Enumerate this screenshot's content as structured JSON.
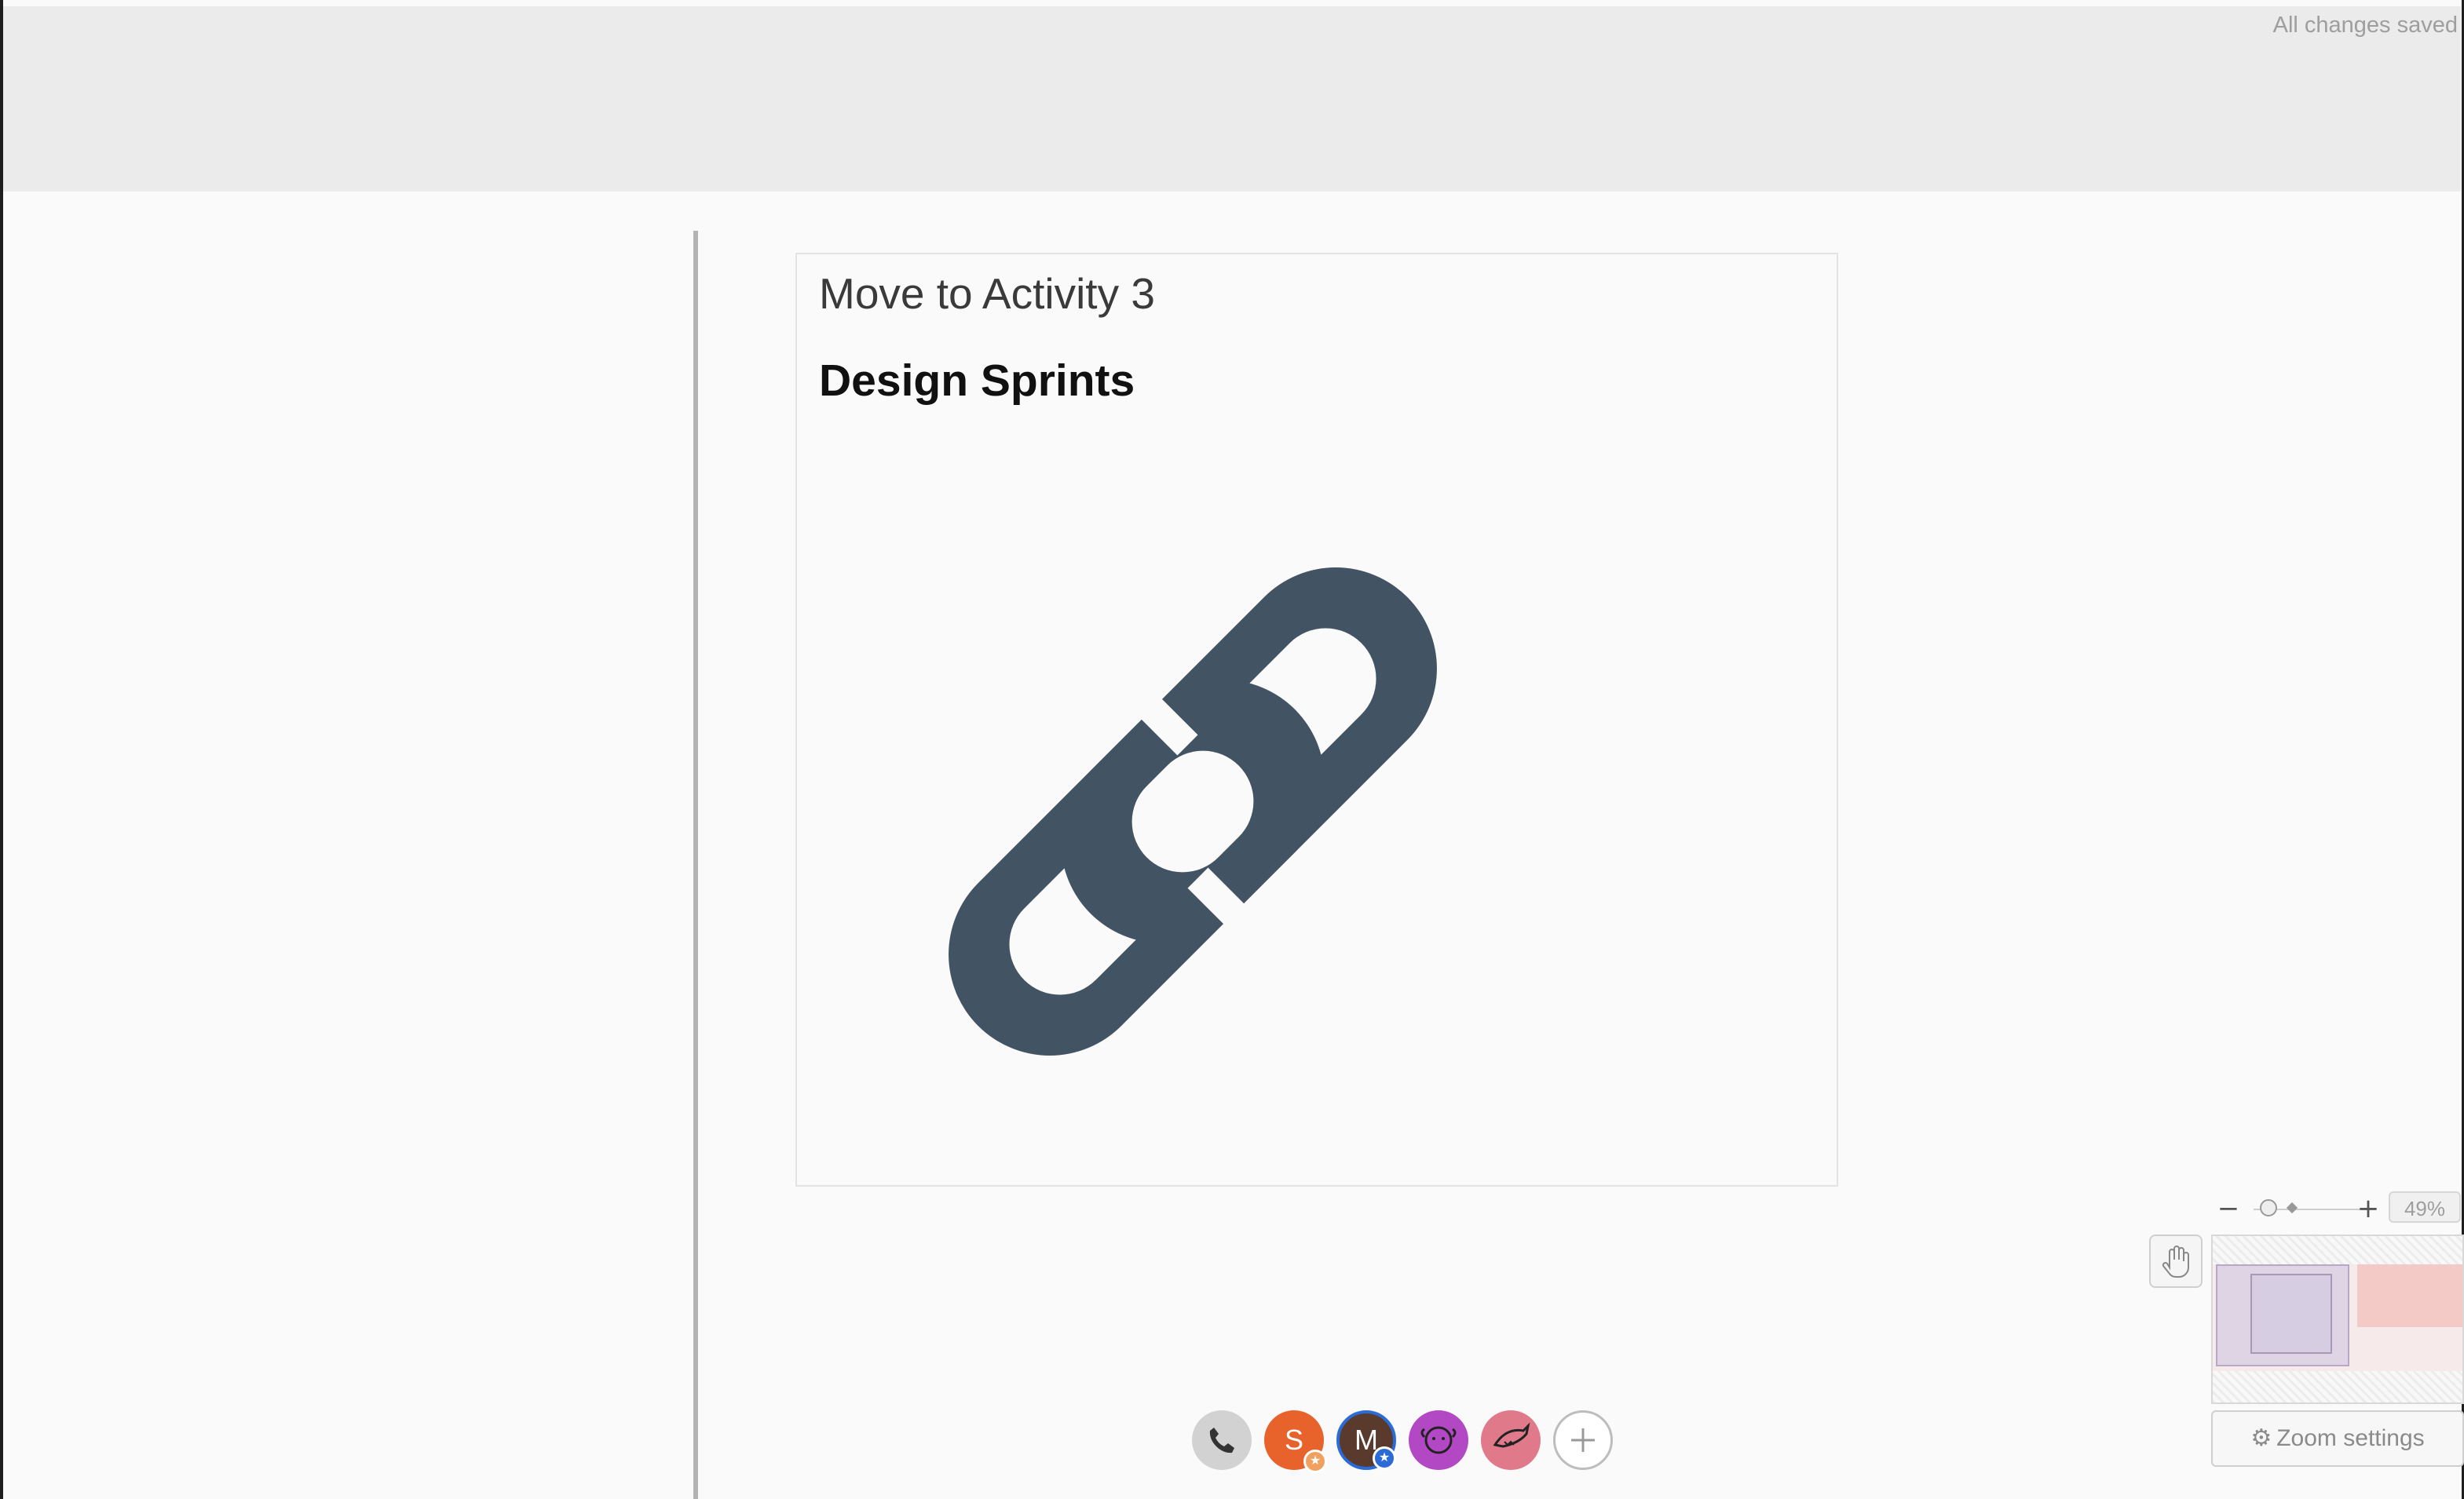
{
  "header": {
    "save_status": "All changes saved"
  },
  "card": {
    "title": "Move to Activity 3",
    "subtitle": "Design Sprints",
    "graphic": "link-icon"
  },
  "zoom": {
    "minus_label": "−",
    "plus_label": "+",
    "percent": "49%",
    "slider_value": 0.49,
    "settings_label": "Zoom settings",
    "settings_icon": "gear-icon"
  },
  "participants": [
    {
      "initial": "",
      "icon": "phone-icon",
      "color": "#cfcfcf"
    },
    {
      "initial": "S",
      "color": "#e8622c",
      "badge_color": "#f0a060"
    },
    {
      "initial": "M",
      "color": "#5b3a2e",
      "badge_color": "#2a6bd6"
    },
    {
      "initial": "",
      "icon": "sheep-icon",
      "color": "#b248c4"
    },
    {
      "initial": "",
      "icon": "shark-icon",
      "color": "#e07a8a"
    },
    {
      "initial": "",
      "icon": "add-participant-icon",
      "color": "#ffffff"
    }
  ],
  "colors": {
    "link_icon": "#425363",
    "header_bg": "#ebebeb",
    "page_bg": "#fafafa"
  }
}
